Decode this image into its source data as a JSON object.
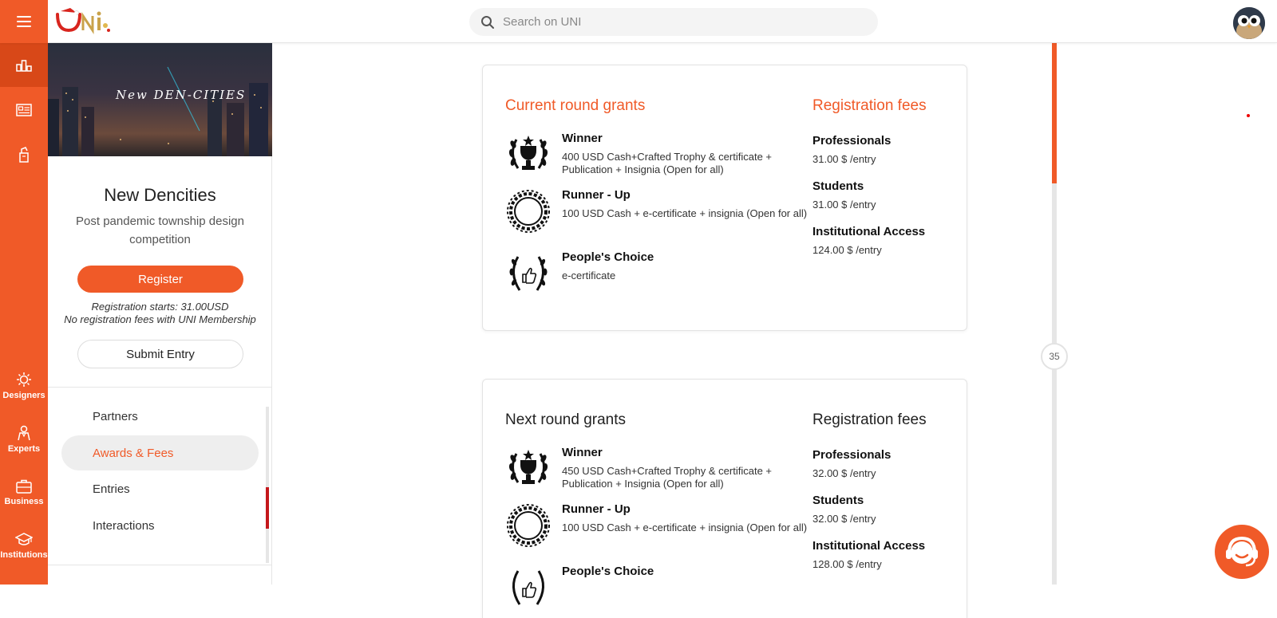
{
  "header": {
    "search_placeholder": "Search on UNI",
    "logo_alt": "UNI"
  },
  "rail": {
    "items": [
      {
        "label": "Designers",
        "icon": "designers-icon"
      },
      {
        "label": "Experts",
        "icon": "experts-icon"
      },
      {
        "label": "Business",
        "icon": "business-icon"
      },
      {
        "label": "Institutions",
        "icon": "institutions-icon"
      }
    ],
    "top_icons": [
      "competitions-icon",
      "listing-icon",
      "document-icon"
    ]
  },
  "competition": {
    "cover_text": "New DEN-CITIES",
    "title": "New Dencities",
    "subtitle": "Post pandemic township design competition",
    "register_label": "Register",
    "registration_note_1": "Registration starts: 31.00USD",
    "registration_note_2": "No registration fees with UNI Membership",
    "submit_label": "Submit Entry"
  },
  "nav": {
    "items": [
      {
        "label": "Partners",
        "active": false
      },
      {
        "label": "Awards & Fees",
        "active": true
      },
      {
        "label": "Entries",
        "active": false
      },
      {
        "label": "Interactions",
        "active": false
      }
    ]
  },
  "current_round": {
    "grants_title": "Current round grants",
    "fees_title": "Registration fees",
    "awards": [
      {
        "name": "Winner",
        "desc": "400 USD Cash+Crafted Trophy & certificate + Publication + Insignia (Open for all)",
        "icon": "trophy-laurel-icon"
      },
      {
        "name": "Runner - Up",
        "desc": "100 USD Cash + e-certificate + insignia (Open for all)",
        "icon": "laurel-wreath-icon"
      },
      {
        "name": "People's Choice",
        "desc": "e-certificate",
        "icon": "thumbs-up-laurel-icon"
      }
    ],
    "fees": [
      {
        "name": "Professionals",
        "value": "31.00 $ /entry"
      },
      {
        "name": "Students",
        "value": "31.00 $ /entry"
      },
      {
        "name": "Institutional Access",
        "value": "124.00 $ /entry"
      }
    ]
  },
  "next_round": {
    "grants_title": "Next round grants",
    "fees_title": "Registration fees",
    "awards": [
      {
        "name": "Winner",
        "desc": "450 USD Cash+Crafted Trophy & certificate + Publication + Insignia (Open for all)",
        "icon": "trophy-laurel-icon"
      },
      {
        "name": "Runner - Up",
        "desc": "100 USD Cash + e-certificate + insignia (Open for all)",
        "icon": "laurel-wreath-icon"
      },
      {
        "name": "People's Choice",
        "desc": "",
        "icon": "thumbs-up-laurel-icon"
      }
    ],
    "fees": [
      {
        "name": "Professionals",
        "value": "32.00 $ /entry"
      },
      {
        "name": "Students",
        "value": "32.00 $ /entry"
      },
      {
        "name": "Institutional Access",
        "value": "128.00 $ /entry"
      }
    ]
  },
  "timeline": {
    "badge": "35"
  },
  "colors": {
    "accent": "#f05a28",
    "accent_dark": "#d84818",
    "scroll_thumb": "#c4171b"
  }
}
